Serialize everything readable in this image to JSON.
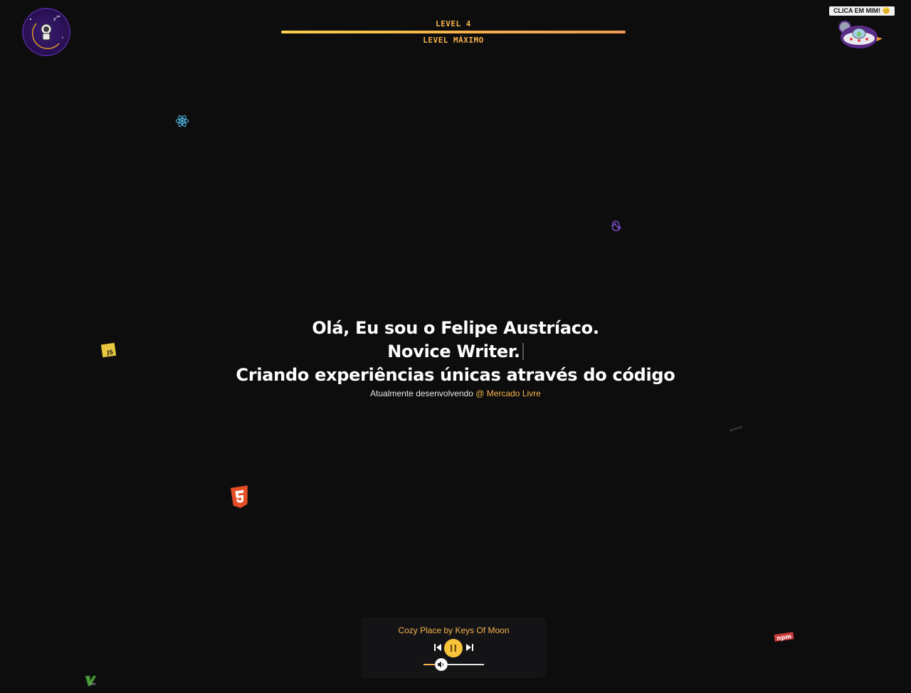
{
  "header": {
    "avatar_icon": "astronaut-moon-avatar-icon",
    "level_label": "LEVEL 4",
    "level_status": "LEVEL MÁXIMO",
    "level_progress": 1.0,
    "click_badge": "CLICA EM MIM! 😊",
    "ufo_icon": "ufo-icon"
  },
  "floating_icons": [
    "react-icon",
    "redux-icon",
    "javascript-icon",
    "html5-icon",
    "npm-icon",
    "vim-icon",
    "meteor-streak-icon"
  ],
  "hero": {
    "line1": "Olá, Eu sou o Felipe Austríaco.",
    "line2": "Novice Writer.",
    "line3": "Criando experiências únicas através do código",
    "sub_prefix": "Atualmente desenvolvendo",
    "sub_link": "@ Mercado Livre"
  },
  "player": {
    "track_title": "Cozy Place by Keys Of Moon",
    "prev_icon": "skip-previous-icon",
    "play_icon": "pause-icon",
    "next_icon": "skip-next-icon",
    "volume_icon": "volume-icon",
    "volume_level": 0.3
  },
  "colors": {
    "background": "#0d0d0e",
    "accent": "#f6b24b",
    "text": "#ffffff"
  }
}
